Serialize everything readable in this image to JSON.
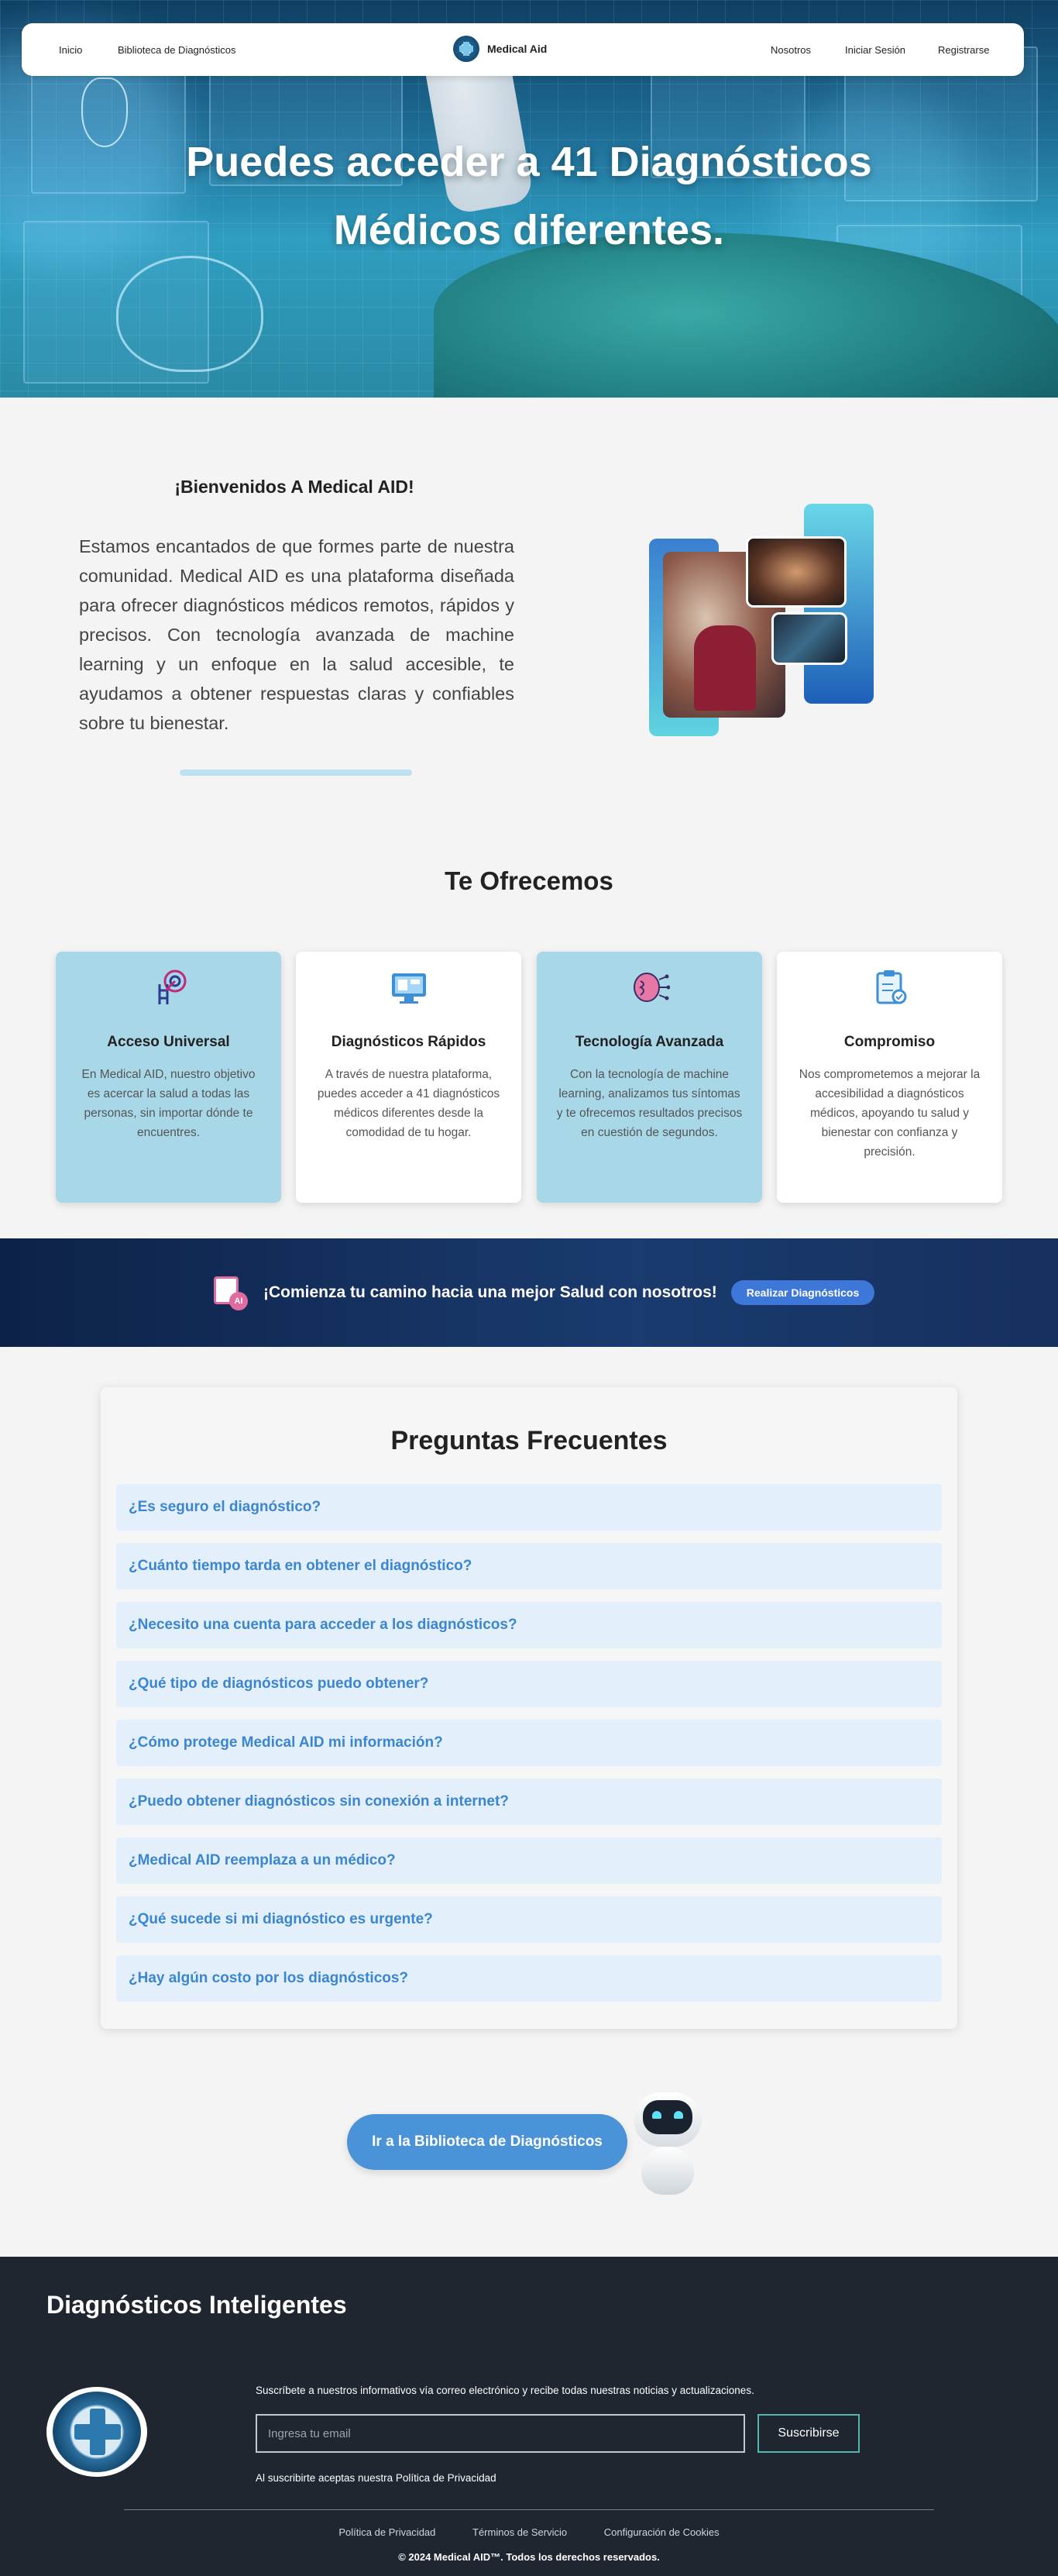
{
  "nav": {
    "links_left": [
      "Inicio",
      "Biblioteca de Diagnósticos"
    ],
    "brand": "Medical Aid",
    "links_right": [
      "Nosotros",
      "Iniciar Sesión",
      "Registrarse"
    ]
  },
  "hero": {
    "title_line1": "Puedes acceder a 41 Diagnósticos",
    "title_line2": "Médicos diferentes."
  },
  "welcome": {
    "title": "¡Bienvenidos A Medical AID!",
    "text": "Estamos encantados de que formes parte de nuestra comunidad. Medical AID es una plataforma diseñada para ofrecer diagnósticos médicos remotos, rápidos y precisos. Con tecnología avanzada de machine learning y un enfoque en la salud accesible, te ayudamos a obtener respuestas claras y confiables sobre tu bienestar."
  },
  "offer": {
    "title": "Te Ofrecemos",
    "cards": [
      {
        "icon": "ladder-target-icon",
        "title": "Acceso Universal",
        "text": "En Medical AID, nuestro objetivo es acercar la salud a todas las personas, sin importar dónde te encuentres."
      },
      {
        "icon": "monitor-icon",
        "title": "Diagnósticos Rápidos",
        "text": "A través de nuestra plataforma, puedes acceder a 41 diagnósticos médicos diferentes desde la comodidad de tu hogar."
      },
      {
        "icon": "brain-circuit-icon",
        "title": "Tecnología Avanzada",
        "text": "Con la tecnología de machine learning, analizamos tus síntomas y te ofrecemos resultados precisos en cuestión de segundos."
      },
      {
        "icon": "clipboard-icon",
        "title": "Compromiso",
        "text": "Nos comprometemos a mejorar la accesibilidad a diagnósticos médicos, apoyando tu salud y bienestar con confianza y precisión."
      }
    ]
  },
  "band": {
    "icon_badge": "AI",
    "text": "¡Comienza tu camino hacia una mejor Salud con nosotros!",
    "button": "Realizar Diagnósticos"
  },
  "faq": {
    "title": "Preguntas Frecuentes",
    "items": [
      "¿Es seguro el diagnóstico?",
      "¿Cuánto tiempo tarda en obtener el diagnóstico?",
      "¿Necesito una cuenta para acceder a los diagnósticos?",
      "¿Qué tipo de diagnósticos puedo obtener?",
      "¿Cómo protege Medical AID mi información?",
      "¿Puedo obtener diagnósticos sin conexión a internet?",
      "¿Medical AID reemplaza a un médico?",
      "¿Qué sucede si mi diagnóstico es urgente?",
      "¿Hay algún costo por los diagnósticos?"
    ]
  },
  "library_button": "Ir a la Biblioteca de Diagnósticos",
  "footer": {
    "title": "Diagnósticos Inteligentes",
    "subscribe_text": "Suscríbete a nuestros informativos vía correo electrónico y recibe todas nuestras noticias y actualizaciones.",
    "email_placeholder": "Ingresa tu email",
    "subscribe_button": "Suscribirse",
    "policy_note": "Al suscribirte aceptas nuestra Política de Privacidad",
    "links": [
      "Política de Privacidad",
      "Términos de Servicio",
      "Configuración de Cookies"
    ],
    "copyright": "© 2024 Medical AID™. Todos los derechos reservados."
  }
}
